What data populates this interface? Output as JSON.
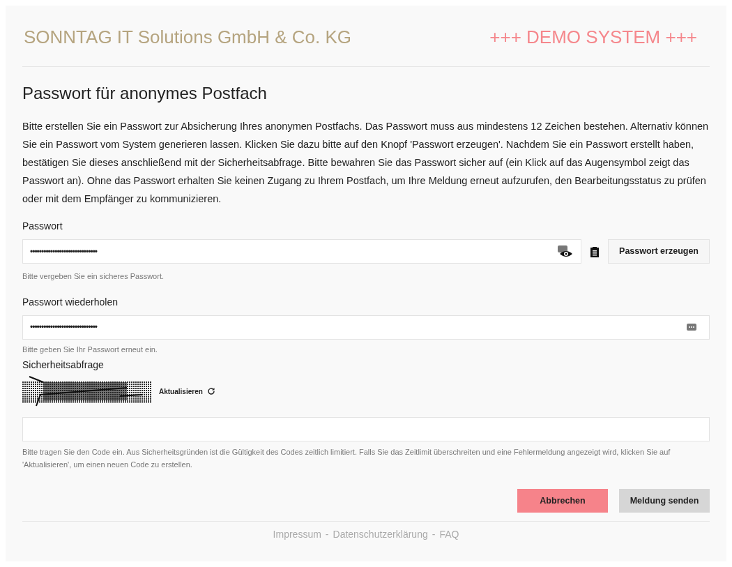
{
  "header": {
    "company": "SONNTAG IT Solutions GmbH & Co. KG",
    "badge": "+++ DEMO SYSTEM +++"
  },
  "heading": "Passwort für anonymes Postfach",
  "intro": "Bitte erstellen Sie ein Passwort zur Absicherung Ihres anonymen Postfachs. Das Passwort muss aus mindestens 12 Zeichen bestehen. Alternativ können Sie ein Passwort vom System generieren lassen. Klicken Sie dazu bitte auf den Knopf 'Passwort erzeugen'. Nachdem Sie ein Passwort erstellt haben, bestätigen Sie dieses anschließend mit der Sicherheitsabfrage. Bitte bewahren Sie das Passwort sicher auf (ein Klick auf das Augensymbol zeigt das Passwort an). Ohne das Passwort erhalten Sie keinen Zugang zu Ihrem Postfach, um Ihre Meldung erneut aufzurufen, den Bearbeitungsstatus zu prüfen oder mit dem Empfänger zu kommunizieren.",
  "password": {
    "label": "Passwort",
    "value": "••••••••••••••••••••••••••••••",
    "hint": "Bitte vergeben Sie ein sicheres Passwort.",
    "generate_button": "Passwort erzeugen"
  },
  "password_repeat": {
    "label": "Passwort wiederholen",
    "value": "••••••••••••••••••••••••••••••",
    "hint": "Bitte geben Sie Ihr Passwort erneut ein."
  },
  "captcha": {
    "label": "Sicherheitsabfrage",
    "refresh": "Aktualisieren",
    "hint": "Bitte tragen Sie den Code ein. Aus Sicherheitsgründen ist die Gültigkeit des Codes zeitlich limitiert. Falls Sie das Zeitlimit überschreiten und eine Fehlermeldung angezeigt wird, klicken Sie auf 'Aktualisieren', um einen neuen Code zu erstellen."
  },
  "buttons": [
    {
      "label": "Abbrechen",
      "kind": "danger"
    },
    {
      "label": "Meldung senden",
      "kind": "secondary"
    }
  ],
  "footer": {
    "separator": "-",
    "links": [
      "Impressum",
      "Datenschutzerklärung",
      "FAQ"
    ]
  }
}
